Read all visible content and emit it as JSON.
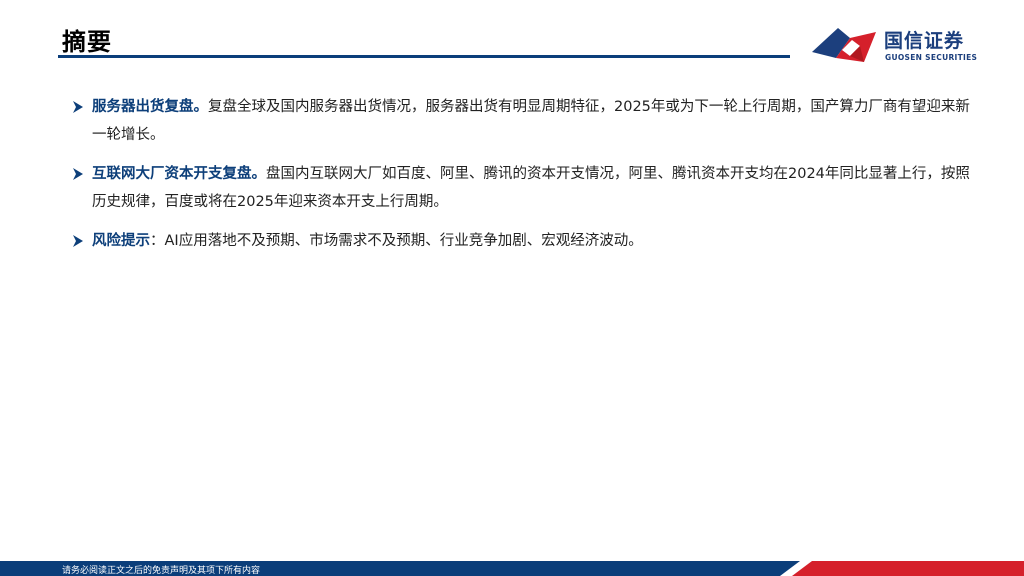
{
  "header": {
    "title": "摘要",
    "logo_cn": "国信证券",
    "logo_en": "GUOSEN SECURITIES"
  },
  "bullets": [
    {
      "lead": "服务器出货复盘。",
      "text": "复盘全球及国内服务器出货情况，服务器出货有明显周期特征，2025年或为下一轮上行周期，国产算力厂商有望迎来新一轮增长。"
    },
    {
      "lead": "互联网大厂资本开支复盘。",
      "text": "盘国内互联网大厂如百度、阿里、腾讯的资本开支情况，阿里、腾讯资本开支均在2024年同比显著上行，按照历史规律，百度或将在2025年迎来资本开支上行周期。"
    },
    {
      "lead": "风险提示",
      "separator": "：",
      "text": "AI应用落地不及预期、市场需求不及预期、行业竞争加剧、宏观经济波动。"
    }
  ],
  "footer": {
    "disclaimer": "请务必阅读正文之后的免责声明及其项下所有内容"
  },
  "colors": {
    "brand_blue": "#0b3e7a",
    "brand_red": "#d5202b",
    "lead_blue": "#0d3f7a"
  }
}
